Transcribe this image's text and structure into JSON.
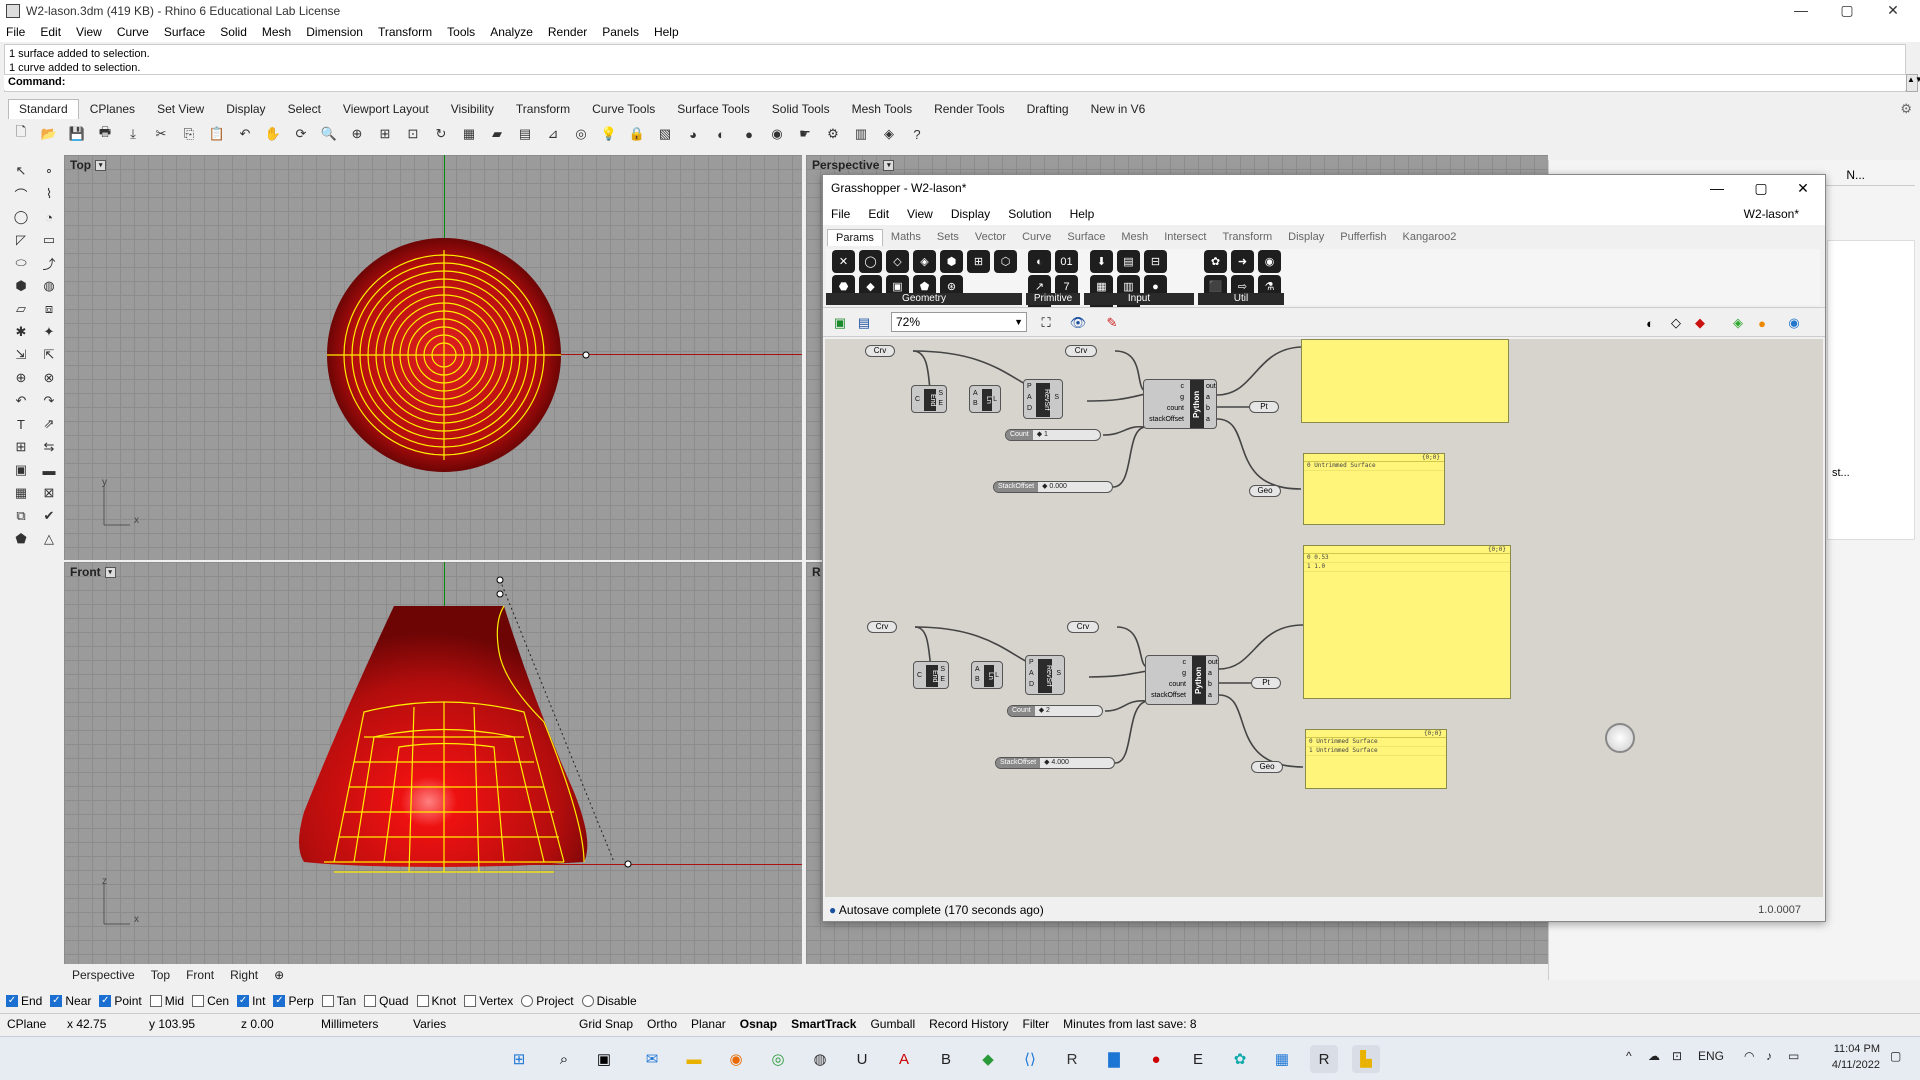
{
  "window": {
    "title": "W2-lason.3dm (419 KB) - Rhino 6 Educational Lab License",
    "controls": [
      "—",
      "▢",
      "✕"
    ]
  },
  "menu": [
    "File",
    "Edit",
    "View",
    "Curve",
    "Surface",
    "Solid",
    "Mesh",
    "Dimension",
    "Transform",
    "Tools",
    "Analyze",
    "Render",
    "Panels",
    "Help"
  ],
  "command": {
    "history": [
      "1 surface added to selection.",
      "1 curve added to selection."
    ],
    "prompt": "Command:"
  },
  "toolbar_tabs": [
    "Standard",
    "CPlanes",
    "Set View",
    "Display",
    "Select",
    "Viewport Layout",
    "Visibility",
    "Transform",
    "Curve Tools",
    "Surface Tools",
    "Solid Tools",
    "Mesh Tools",
    "Render Tools",
    "Drafting",
    "New in V6"
  ],
  "toolbar_tabs_active": "Standard",
  "std_icons": [
    "new-icon",
    "open-icon",
    "save-icon",
    "print-icon",
    "import-icon",
    "cut-icon",
    "copy-icon",
    "paste-icon",
    "undo-icon",
    "pan-icon",
    "rotate-view-icon",
    "zoom-icon",
    "zoom-window-icon",
    "zoom-extents-icon",
    "zoom-selected-icon",
    "rotate-icon",
    "four-viewports-icon",
    "car-icon",
    "grid-icon",
    "cplane-icon",
    "target-icon",
    "light-icon",
    "lock-icon",
    "layer-icon",
    "color-wheel-icon",
    "material-icon",
    "sphere-icon",
    "render-icon",
    "pointer-icon",
    "gear-icon",
    "spreadsheet-icon",
    "grasshopper-icon",
    "help-icon"
  ],
  "viewports": {
    "top": {
      "label": "Top"
    },
    "perspective": {
      "label": "Perspective"
    },
    "front": {
      "label": "Front"
    },
    "right": {
      "label": "R"
    },
    "axis_x": "x",
    "axis_y": "y",
    "axis_z": "z"
  },
  "viewport_tabs": [
    "Perspective",
    "Top",
    "Front",
    "Right",
    "⊕"
  ],
  "osnaps": [
    {
      "label": "End",
      "on": true
    },
    {
      "label": "Near",
      "on": true
    },
    {
      "label": "Point",
      "on": true
    },
    {
      "label": "Mid",
      "on": false
    },
    {
      "label": "Cen",
      "on": false
    },
    {
      "label": "Int",
      "on": true
    },
    {
      "label": "Perp",
      "on": true
    },
    {
      "label": "Tan",
      "on": false
    },
    {
      "label": "Quad",
      "on": false
    },
    {
      "label": "Knot",
      "on": false
    },
    {
      "label": "Vertex",
      "on": false
    },
    {
      "label": "Project",
      "on": false
    },
    {
      "label": "Disable",
      "on": false
    }
  ],
  "status": {
    "cplane": "CPlane",
    "x": "x 42.75",
    "y": "y 103.95",
    "z": "z 0.00",
    "units": "Millimeters",
    "layer": "Varies",
    "grid_snap": "Grid Snap",
    "ortho": "Ortho",
    "planar": "Planar",
    "osnap": "Osnap",
    "smarttrack": "SmartTrack",
    "gumball": "Gumball",
    "record_history": "Record History",
    "filter": "Filter",
    "save_info": "Minutes from last save: 8"
  },
  "grasshopper": {
    "title": "Grasshopper - W2-lason*",
    "menu": [
      "File",
      "Edit",
      "View",
      "Display",
      "Solution",
      "Help"
    ],
    "doc_name": "W2-lason*",
    "tabs": [
      "Params",
      "Maths",
      "Sets",
      "Vector",
      "Curve",
      "Surface",
      "Mesh",
      "Intersect",
      "Transform",
      "Display",
      "Pufferfish",
      "Kangaroo2"
    ],
    "active_tab": "Params",
    "groups": [
      {
        "label": "Geometry",
        "icons": [
          "✕",
          "◯",
          "◇",
          "◈",
          "⬢",
          "⊞",
          "⬡",
          "⬣",
          "◆",
          "▣",
          "⬟",
          "⊛"
        ]
      },
      {
        "label": "Primitive",
        "icons": [
          "◐",
          "01",
          "↗",
          "7",
          "A"
        ]
      },
      {
        "label": "Input",
        "icons": [
          "⬇",
          "▤",
          "⊟",
          "▦",
          "▥",
          "●",
          "≡",
          "▩"
        ]
      },
      {
        "label": "Util",
        "icons": [
          "✿",
          "➜",
          "◉",
          "⬛",
          "⇨",
          "⚗"
        ]
      }
    ],
    "zoom": "72%",
    "status": "Autosave complete (170 seconds ago)",
    "version": "1.0.0007",
    "nodes": {
      "crv": "Crv",
      "end": "End",
      "ln": "Ln",
      "revsrf": "RevSrf",
      "python": "Python",
      "pt": "Pt",
      "geo": "Geo",
      "count1": "Count",
      "count1_val": "◆ 1",
      "count2": "Count",
      "count2_val": "◆ 2",
      "stackoffset1": "StackOffset",
      "stackoffset1_val": "◆ 0.000",
      "stackoffset2": "StackOffset",
      "stackoffset2_val": "◆ 4.000",
      "py_inputs": [
        "c",
        "g",
        "count",
        "stackOffset"
      ],
      "py_outputs": [
        "out",
        "a",
        "b",
        "a"
      ],
      "end_in": "C",
      "end_out": [
        "S",
        "E"
      ],
      "ln_in": [
        "A",
        "B"
      ],
      "ln_out": "L",
      "rev_in": [
        "P",
        "A",
        "D"
      ],
      "rev_out": "S"
    },
    "panels": {
      "p2_header": "{0;0}",
      "p2_lines": [
        "0 Untrimmed Surface"
      ],
      "p3_header": "{0;0}",
      "p3_lines": [
        "0 0.53",
        "1 1.0"
      ],
      "p4_header": "{0;0}",
      "p4_lines": [
        "0 Untrimmed Surface",
        "1 Untrimmed Surface"
      ]
    }
  },
  "right_panel": {
    "tabs": [
      "N..."
    ],
    "fragment": "st..."
  },
  "taskbar": {
    "lang": "ENG",
    "time": "11:04 PM",
    "date": "4/11/2022"
  },
  "colors": {
    "object_red": "#b30d0d",
    "selection_yellow": "#ffee00",
    "gh_panel": "#fff57a",
    "viewport_grid": "#9b9b9b",
    "accent_blue": "#1a6fd1"
  }
}
